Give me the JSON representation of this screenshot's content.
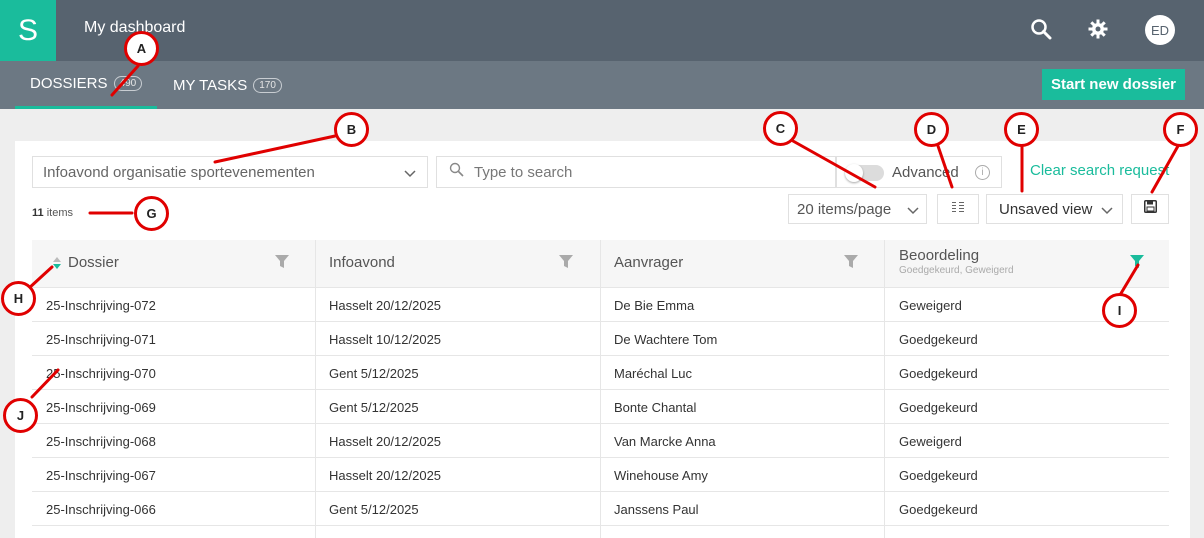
{
  "header": {
    "logo_letter": "S",
    "title": "My dashboard",
    "avatar_initials": "ED",
    "icons": [
      "search-icon",
      "gear-icon"
    ]
  },
  "nav": {
    "tabs": [
      {
        "label": "DOSSIERS",
        "count": "490",
        "active": true
      },
      {
        "label": "MY TASKS",
        "count": "170",
        "active": false
      }
    ],
    "start_button": "Start new dossier"
  },
  "toolbar": {
    "filter_value": "Infoavond organisatie sportevenementen",
    "search_placeholder": "Type to search",
    "advanced_label": "Advanced",
    "advanced_enabled": false,
    "info_glyph": "i",
    "clear_label": "Clear search request",
    "per_page": "20 items/page",
    "view": "Unsaved view",
    "items_count": "11",
    "items_label": "items"
  },
  "table": {
    "columns": [
      {
        "label": "Dossier",
        "sub": ""
      },
      {
        "label": "Infoavond",
        "sub": ""
      },
      {
        "label": "Aanvrager",
        "sub": ""
      },
      {
        "label": "Beoordeling",
        "sub": "Goedgekeurd, Geweigerd"
      }
    ],
    "rows": [
      [
        "25-Inschrijving-072",
        "Hasselt 20/12/2025",
        "De Bie Emma",
        "Geweigerd"
      ],
      [
        "25-Inschrijving-071",
        "Hasselt 10/12/2025",
        "De Wachtere Tom",
        "Goedgekeurd"
      ],
      [
        "25-Inschrijving-070",
        "Gent 5/12/2025",
        "Maréchal Luc",
        "Goedgekeurd"
      ],
      [
        "25-Inschrijving-069",
        "Gent 5/12/2025",
        "Bonte Chantal",
        "Goedgekeurd"
      ],
      [
        "25-Inschrijving-068",
        "Hasselt 20/12/2025",
        "Van Marcke Anna",
        "Geweigerd"
      ],
      [
        "25-Inschrijving-067",
        "Hasselt 20/12/2025",
        "Winehouse Amy",
        "Goedgekeurd"
      ],
      [
        "25-Inschrijving-066",
        "Gent 5/12/2025",
        "Janssens Paul",
        "Goedgekeurd"
      ]
    ]
  },
  "annotations": [
    "A",
    "B",
    "C",
    "D",
    "E",
    "F",
    "G",
    "H",
    "I",
    "J"
  ],
  "colors": {
    "accent": "#1abc9c",
    "header": "#57636f",
    "subnav": "#6c7883",
    "annotation": "#e00000"
  }
}
